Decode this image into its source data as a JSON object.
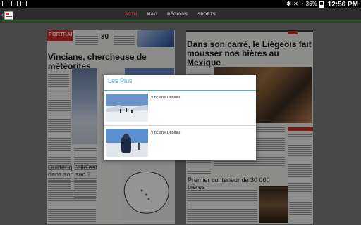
{
  "status_bar": {
    "battery": "36%",
    "time": "12:56 PM"
  },
  "nav": {
    "tabs": [
      {
        "label": "ACTU",
        "active": true
      },
      {
        "label": "MAG",
        "active": false
      },
      {
        "label": "RÉGIONS",
        "active": false
      },
      {
        "label": "SPORTS",
        "active": false
      }
    ]
  },
  "paper": {
    "left_section": "PORTRAIT",
    "left_number": "30",
    "left_headline": "Vinciane, chercheuse de météorites",
    "left_bottom_heading": "Quitter qu'elle est dans son sac ?",
    "right_headline": "Dans son carré, le Liégeois fait mousser nos bières au Mexique",
    "right_bottom_heading": "Premier conteneur de 30 000 bières"
  },
  "dialog": {
    "title": "Les Plus",
    "items": [
      {
        "title": "Vinciane Debaille"
      },
      {
        "title": "Vinciane Debaille"
      }
    ]
  },
  "colors": {
    "accent": "#33b5e5",
    "active_tab": "#dd3333",
    "action_bar_underline": "#1f5e1c"
  }
}
